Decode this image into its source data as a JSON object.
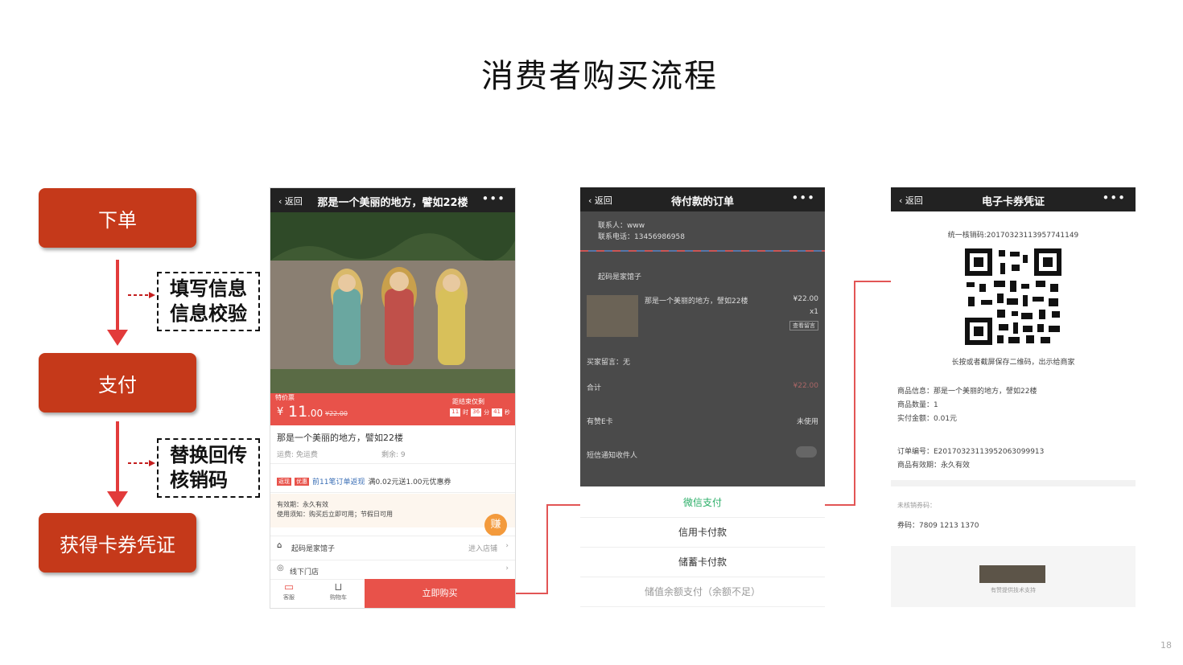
{
  "title": "消费者购买流程",
  "flow": {
    "steps": [
      "下单",
      "支付",
      "获得卡券凭证"
    ],
    "notes": [
      {
        "line1": "填写信息",
        "line2": "信息校验"
      },
      {
        "line1": "替换回传",
        "line2": "核销码"
      }
    ]
  },
  "phone1": {
    "back": "返回",
    "title": "那是一个美丽的地方，譬如22楼",
    "more": "•••",
    "price_tag": "特价票",
    "price_symbol": "¥",
    "price_int": "11",
    "price_dec": ".00",
    "price_orig": "¥22.00",
    "countdown_label": "距结束仅剩",
    "countdown": [
      "11",
      "时",
      "36",
      "分",
      "41",
      "秒"
    ],
    "product_name": "那是一个美丽的地方，譬如22楼",
    "shipping": "运费: 免运费",
    "stock": "剩余: 9",
    "promo_tag1": "返现",
    "promo_tag2": "优惠",
    "promo_text": "前11笔订单返现",
    "promo_text2": "满0.02元送1.00元优惠券",
    "validity": "有效期：永久有效",
    "usage": "使用须知：购买后立即可用；节假日可用",
    "earn": "赚",
    "shop_name": "起码是家馆子",
    "shop_link": "进入店铺",
    "offline": "线下门店",
    "nav_service": "客服",
    "nav_cart": "购物车",
    "buy_button": "立即购买"
  },
  "phone2": {
    "back": "返回",
    "title": "待付款的订单",
    "more": "•••",
    "contact_name": "联系人：www",
    "contact_phone": "联系电话：13456986958",
    "shop": "起码是家馆子",
    "item_name": "那是一个美丽的地方，譬如22楼",
    "item_price": "¥22.00",
    "item_qty": "x1",
    "item_btn": "查看留言",
    "buyer_msg": "买家留言：无",
    "total_label": "合计",
    "total_value": "¥22.00",
    "card_label": "有赞E卡",
    "card_value": "未使用",
    "notify_label": "短信通知收件人",
    "pay_options": [
      "微信支付",
      "信用卡付款",
      "储蓄卡付款",
      "储值余额支付（余额不足）"
    ]
  },
  "phone3": {
    "back": "返回",
    "title": "电子卡券凭证",
    "more": "•••",
    "code_label": "统一核销码:2017032311395774114​9",
    "qr_hint": "长按或者截屏保存二维码，出示给商家",
    "info_name": "商品信息：那是一个美丽的地方，譬如22楼",
    "info_qty": "商品数量：1",
    "info_amount": "实付金额：0.01元",
    "order_no": "订单编号：E20170323113952063099913",
    "valid": "商品有效期：永久有效",
    "unused_label": "未核销券码：",
    "voucher_code": "券码：7809 1213 1370",
    "footer": "有赞提供技术支持"
  },
  "page_number": "18",
  "colors": {
    "step": "#c5391a",
    "accent": "#e23b3b",
    "wechat": "#2aae67"
  }
}
